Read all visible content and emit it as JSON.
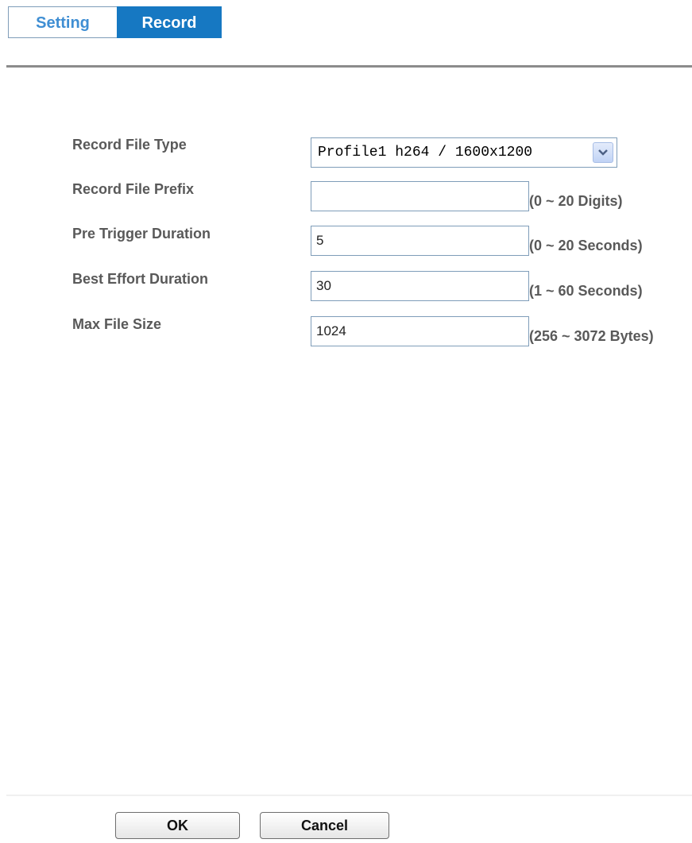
{
  "tabs": [
    {
      "label": "Setting",
      "active": false
    },
    {
      "label": "Record",
      "active": true
    }
  ],
  "form": {
    "record_file_type": {
      "label": "Record File Type",
      "selected": "Profile1 h264 / 1600x1200",
      "icon": "chevron-down-icon"
    },
    "record_file_prefix": {
      "label": "Record File Prefix",
      "value": "",
      "hint": "(0 ~ 20 Digits)"
    },
    "pre_trigger_duration": {
      "label": "Pre Trigger Duration",
      "value": "5",
      "hint": "(0 ~ 20 Seconds)"
    },
    "best_effort_duration": {
      "label": "Best Effort Duration",
      "value": "30",
      "hint": "(1 ~ 60 Seconds)"
    },
    "max_file_size": {
      "label": "Max File Size",
      "value": "1024",
      "hint": "(256 ~ 3072 Bytes)"
    }
  },
  "buttons": {
    "ok_label": "OK",
    "cancel_label": "Cancel"
  },
  "colors": {
    "active_tab": "#1678c2",
    "inactive_tab_text": "#3f8ed3",
    "label_text": "#595959"
  }
}
